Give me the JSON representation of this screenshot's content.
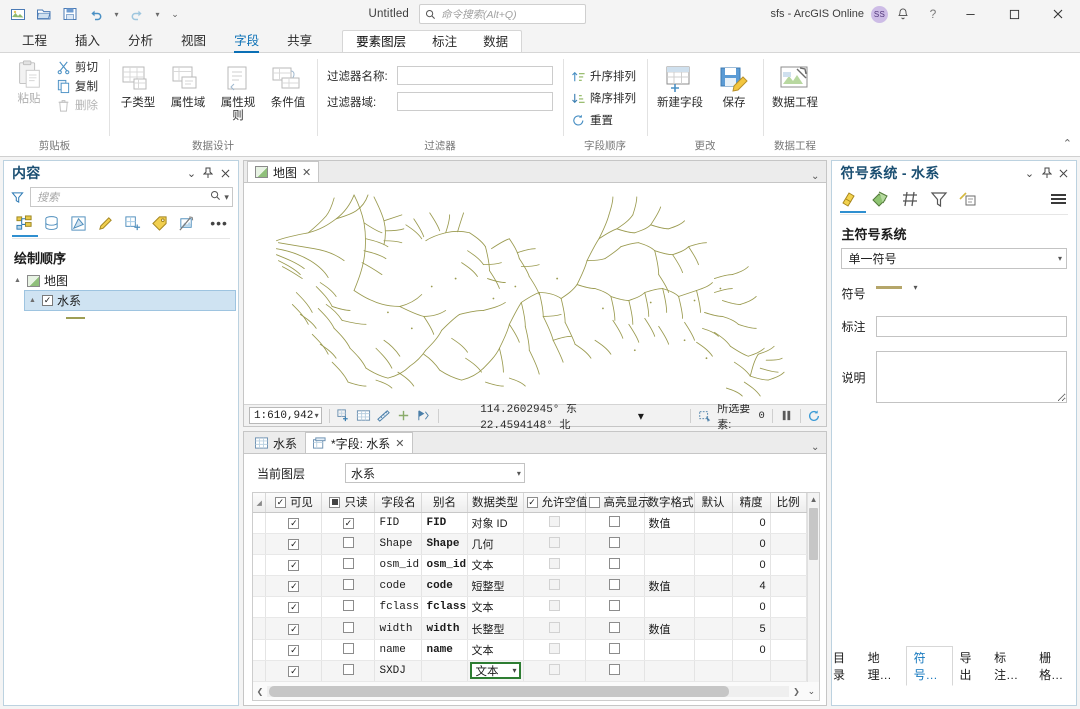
{
  "titlebar": {
    "doc_title": "Untitled",
    "search_placeholder": "命令搜索(Alt+Q)",
    "user": "sfs - ArcGIS Online",
    "avatar_initials": "SS",
    "qat": [
      "new-project",
      "open-project",
      "save-project",
      "undo",
      "undo-dropdown",
      "redo",
      "redo-dropdown",
      "qat-customize"
    ],
    "help_label": "?",
    "minimize_label": "—",
    "maximize_label": "▢",
    "close_label": "✕"
  },
  "ribbon": {
    "tabs": [
      {
        "label": "工程",
        "active": false
      },
      {
        "label": "插入",
        "active": false
      },
      {
        "label": "分析",
        "active": false
      },
      {
        "label": "视图",
        "active": false
      },
      {
        "label": "字段",
        "active": true
      },
      {
        "label": "共享",
        "active": false
      }
    ],
    "context_tabs": [
      {
        "label": "要素图层",
        "active": true
      },
      {
        "label": "标注",
        "active": false
      },
      {
        "label": "数据",
        "active": false
      }
    ],
    "groups": [
      {
        "name": "clipboard",
        "label": "剪贴板",
        "big": [
          {
            "label": "粘贴",
            "disabled": true
          }
        ],
        "small": [
          {
            "label": "剪切",
            "icon": "scissors-icon",
            "disabled": false
          },
          {
            "label": "复制",
            "icon": "copy-icon",
            "disabled": false
          },
          {
            "label": "删除",
            "icon": "trash-icon",
            "disabled": true
          }
        ]
      },
      {
        "name": "data-design",
        "label": "数据设计",
        "big": [
          {
            "label": "子类型",
            "disabled": false
          },
          {
            "label": "属性域",
            "disabled": false
          },
          {
            "label": "属性规则",
            "disabled": false
          },
          {
            "label": "条件值",
            "disabled": false
          }
        ],
        "small": []
      },
      {
        "name": "filter",
        "label": "过滤器",
        "fields": [
          {
            "label": "过滤器名称:",
            "value": "",
            "name": "filter-name-input"
          },
          {
            "label": "过滤器域:",
            "value": "",
            "name": "filter-domain-input"
          }
        ]
      },
      {
        "name": "field-order",
        "label": "字段顺序",
        "small": [
          {
            "label": "升序排列",
            "icon": "sort-ascending-icon",
            "disabled": false
          },
          {
            "label": "降序排列",
            "icon": "sort-descending-icon",
            "disabled": false
          },
          {
            "label": "重置",
            "icon": "reset-icon",
            "disabled": false
          }
        ]
      },
      {
        "name": "changes",
        "label": "更改",
        "big": [
          {
            "label": "新建字段",
            "disabled": false
          },
          {
            "label": "保存",
            "disabled": false
          }
        ]
      },
      {
        "name": "data-engineering",
        "label": "数据工程",
        "big": [
          {
            "label": "数据工程",
            "disabled": false
          }
        ]
      }
    ]
  },
  "contents": {
    "title": "内容",
    "search_placeholder": "搜索",
    "draw_order": "绘制顺序",
    "tools": [
      "list-by-drawing-order-icon",
      "list-by-data-source-icon",
      "list-by-selection-icon",
      "list-by-editing-icon",
      "list-by-snapping-icon",
      "list-by-labeling-icon",
      "list-by-diagram-icon"
    ],
    "more_label": "•••",
    "tree": [
      {
        "label": "地图",
        "level": 0,
        "icon": "map-icon",
        "checked": null,
        "selected": false
      },
      {
        "label": "水系",
        "level": 1,
        "icon": null,
        "checked": true,
        "selected": true
      }
    ]
  },
  "mapview": {
    "tabs": [
      {
        "label": "地图",
        "active": true,
        "closable": true
      }
    ],
    "scale": "1:610,942",
    "coordinates": "114.2602945° 东  22.4594148° 北",
    "selected_features_label": "所选要素:",
    "selected_features_count": "0",
    "layer_color": "#9a9a4f",
    "tool_icons": [
      "explore-icon",
      "full-extent-icon",
      "bookmarks-icon",
      "add-data-icon",
      "measure-icon"
    ],
    "pause_icon": "pause-drawing-icon",
    "refresh_icon": "refresh-icon"
  },
  "tableview": {
    "tabs": [
      {
        "label": "水系",
        "active": false,
        "icon": "table-icon",
        "closable": false
      },
      {
        "label": "*字段:  水系",
        "active": true,
        "icon": "fields-icon",
        "closable": true
      }
    ],
    "current_layer_label": "当前图层",
    "current_layer_value": "水系",
    "columns": [
      {
        "label": "可见",
        "header_check": "checked"
      },
      {
        "label": "只读",
        "header_check": "partial"
      },
      {
        "label": "字段名",
        "header_check": null
      },
      {
        "label": "别名",
        "header_check": null
      },
      {
        "label": "数据类型",
        "header_check": null
      },
      {
        "label": "允许空值",
        "header_check": "checked"
      },
      {
        "label": "高亮显示",
        "header_check": "unchecked"
      },
      {
        "label": "数字格式",
        "header_check": null
      },
      {
        "label": "默认",
        "header_check": null
      },
      {
        "label": "精度",
        "header_check": null
      },
      {
        "label": "比例",
        "header_check": null
      }
    ],
    "rows": [
      {
        "visible": true,
        "readonly": true,
        "field": "FID",
        "alias": "FID",
        "type": "对象 ID",
        "nullable": "disabled",
        "highlight": false,
        "numformat": "数值",
        "default": "",
        "precision": "0",
        "scale": "",
        "active": false,
        "editing": false
      },
      {
        "visible": true,
        "readonly": false,
        "field": "Shape",
        "alias": "Shape",
        "type": "几何",
        "nullable": "disabled",
        "highlight": false,
        "numformat": "",
        "default": "",
        "precision": "0",
        "scale": "",
        "active": false,
        "editing": false
      },
      {
        "visible": true,
        "readonly": false,
        "field": "osm_id",
        "alias": "osm_id",
        "type": "文本",
        "nullable": "disabled",
        "highlight": false,
        "numformat": "",
        "default": "",
        "precision": "0",
        "scale": "",
        "active": false,
        "editing": false
      },
      {
        "visible": true,
        "readonly": false,
        "field": "code",
        "alias": "code",
        "type": "短整型",
        "nullable": "disabled",
        "highlight": false,
        "numformat": "数值",
        "default": "",
        "precision": "4",
        "scale": "",
        "active": false,
        "editing": false
      },
      {
        "visible": true,
        "readonly": false,
        "field": "fclass",
        "alias": "fclass",
        "type": "文本",
        "nullable": "disabled",
        "highlight": false,
        "numformat": "",
        "default": "",
        "precision": "0",
        "scale": "",
        "active": false,
        "editing": false
      },
      {
        "visible": true,
        "readonly": false,
        "field": "width",
        "alias": "width",
        "type": "长整型",
        "nullable": "disabled",
        "highlight": false,
        "numformat": "数值",
        "default": "",
        "precision": "5",
        "scale": "",
        "active": false,
        "editing": false
      },
      {
        "visible": true,
        "readonly": false,
        "field": "name",
        "alias": "name",
        "type": "文本",
        "nullable": "disabled",
        "highlight": false,
        "numformat": "",
        "default": "",
        "precision": "0",
        "scale": "",
        "active": false,
        "editing": false
      },
      {
        "visible": true,
        "readonly": false,
        "field": "SXDJ",
        "alias": "",
        "type": "文本",
        "nullable": "disabled",
        "highlight": false,
        "numformat": "",
        "default": "",
        "precision": "",
        "scale": "",
        "active": true,
        "editing": true
      }
    ]
  },
  "symbology": {
    "title": "符号系统 - 水系",
    "tools": [
      "gallery-icon",
      "properties-icon",
      "vary-by-attribute-icon",
      "filter-icon",
      "annotation-icon"
    ],
    "menu_icon": "hamburger-icon",
    "primary_symbology_label": "主符号系统",
    "primary_symbology_value": "单一符号",
    "symbol_label": "符号",
    "symbol_color": "#b5a66a",
    "label_label": "标注",
    "label_value": "",
    "description_label": "说明",
    "description_value": ""
  },
  "bottom_tabs": [
    {
      "label": "目录",
      "active": false
    },
    {
      "label": "地理…",
      "active": false
    },
    {
      "label": "符号…",
      "active": true
    },
    {
      "label": "导出",
      "active": false
    },
    {
      "label": "标注…",
      "active": false
    },
    {
      "label": "栅格…",
      "active": false
    }
  ]
}
